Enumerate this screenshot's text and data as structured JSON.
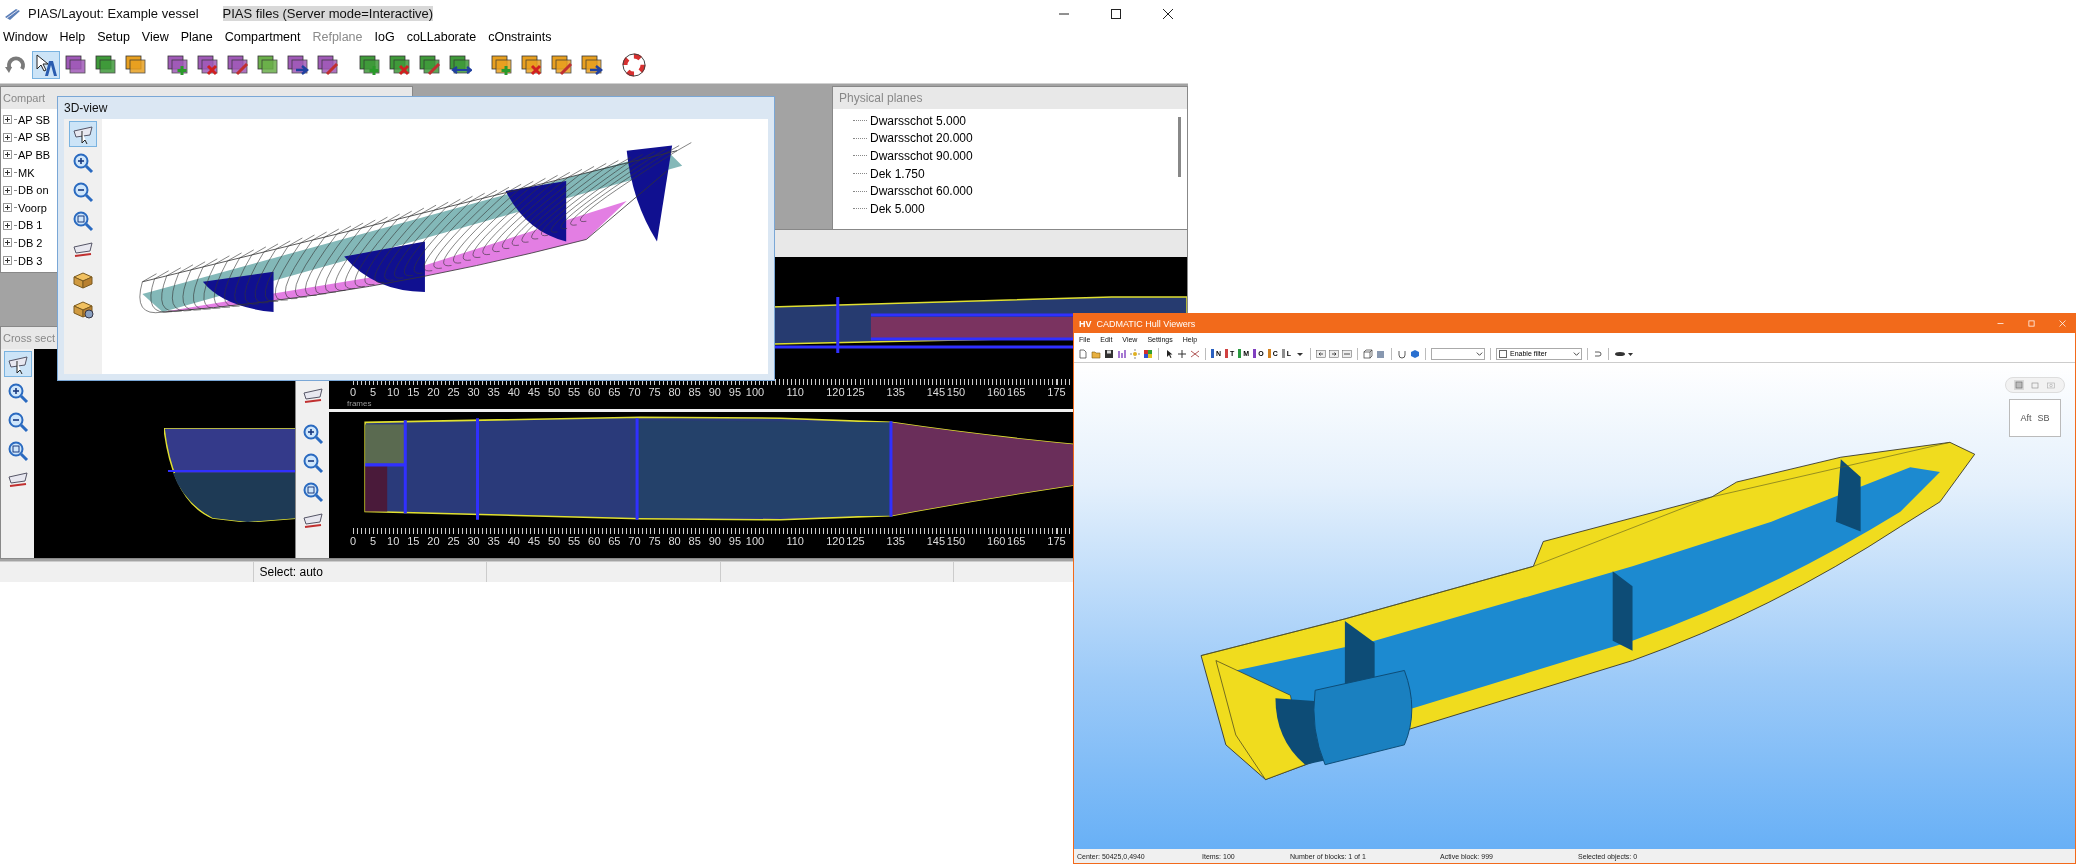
{
  "pias": {
    "title": "PIAS/Layout: Example vessel",
    "subtitle": "PIAS files (Server mode=Interactive)",
    "menu": [
      {
        "label": "Window",
        "disabled": false
      },
      {
        "label": "Help",
        "disabled": false
      },
      {
        "label": "Setup",
        "disabled": false
      },
      {
        "label": "View",
        "disabled": false
      },
      {
        "label": "Plane",
        "disabled": false
      },
      {
        "label": "Compartment",
        "disabled": false
      },
      {
        "label": "Refplane",
        "disabled": true
      },
      {
        "label": "IoG",
        "disabled": false
      },
      {
        "label": "coLLaborate",
        "disabled": false
      },
      {
        "label": "cOnstraints",
        "disabled": false
      }
    ],
    "toolbar": [
      [
        {
          "kind": "undo",
          "color": "#7a7a7a",
          "selected": false
        },
        {
          "kind": "select",
          "color": "#2a5db0",
          "selected": true
        },
        {
          "kind": "stack",
          "color": "#a05ab8",
          "selected": false
        },
        {
          "kind": "stack",
          "color": "#3f9a3a",
          "selected": false
        },
        {
          "kind": "stack",
          "color": "#e8a020",
          "selected": false
        }
      ],
      [
        {
          "kind": "add",
          "color": "#a05ab8",
          "selected": false
        },
        {
          "kind": "delete",
          "color": "#a05ab8",
          "selected": false
        },
        {
          "kind": "edit",
          "color": "#a05ab8",
          "selected": false
        },
        {
          "kind": "stack",
          "color": "#6bb04a",
          "selected": false
        },
        {
          "kind": "move",
          "color": "#a05ab8",
          "selected": false
        },
        {
          "kind": "edit",
          "color": "#a05ab8",
          "selected": false
        }
      ],
      [
        {
          "kind": "add",
          "color": "#3f9a3a",
          "selected": false
        },
        {
          "kind": "delete",
          "color": "#3f9a3a",
          "selected": false
        },
        {
          "kind": "edit",
          "color": "#3f9a3a",
          "selected": false
        },
        {
          "kind": "swap",
          "color": "#3f9a3a",
          "selected": false
        }
      ],
      [
        {
          "kind": "add",
          "color": "#e8a020",
          "selected": false
        },
        {
          "kind": "delete",
          "color": "#e8a020",
          "selected": false
        },
        {
          "kind": "edit",
          "color": "#e8a020",
          "selected": false
        },
        {
          "kind": "move",
          "color": "#e8a020",
          "selected": false
        }
      ],
      [
        {
          "kind": "lifebuoy",
          "color": "#d83030",
          "selected": false
        }
      ]
    ],
    "compartments": {
      "title": "Compart",
      "items": [
        {
          "label": "AP SB",
          "expanded": false
        },
        {
          "label": "AP SB",
          "expanded": false
        },
        {
          "label": "AP BB",
          "expanded": false
        },
        {
          "label": "MK",
          "expanded": false
        },
        {
          "label": "DB on",
          "expanded": false
        },
        {
          "label": "Voorp",
          "expanded": false
        },
        {
          "label": "DB 1",
          "expanded": false
        },
        {
          "label": "DB 2",
          "expanded": false
        },
        {
          "label": "DB 3",
          "expanded": false
        }
      ]
    },
    "physical_planes": {
      "title": "Physical planes",
      "items": [
        "Dwarsschot 5.000",
        "Dwarsschot 20.000",
        "Dwarsschot 90.000",
        "Dek 1.750",
        "Dwarsschot 60.000",
        "Dek 5.000"
      ]
    },
    "view_3d": {
      "title": "3D-view",
      "tools": [
        {
          "kind": "pan",
          "selected": true
        },
        {
          "kind": "zoom-in",
          "selected": false
        },
        {
          "kind": "zoom-out",
          "selected": false
        },
        {
          "kind": "zoom-fit",
          "selected": false
        },
        {
          "kind": "measure",
          "selected": false
        },
        {
          "kind": "box",
          "selected": false
        },
        {
          "kind": "box-gear",
          "selected": false
        }
      ]
    },
    "cross_section": {
      "title": "Cross sect",
      "tools": [
        {
          "kind": "pan",
          "selected": true
        },
        {
          "kind": "zoom-in",
          "selected": false
        },
        {
          "kind": "zoom-out",
          "selected": false
        },
        {
          "kind": "zoom-fit",
          "selected": false
        },
        {
          "kind": "measure",
          "selected": false
        }
      ]
    },
    "side_views": [
      {
        "tools": [
          {
            "kind": "measure",
            "selected": false
          }
        ],
        "ruler": {
          "unit": "frames",
          "ticks": [
            "0",
            "5",
            "10",
            "15",
            "20",
            "25",
            "30",
            "35",
            "40",
            "45",
            "50",
            "55",
            "60",
            "65",
            "70",
            "75",
            "80",
            "85",
            "90",
            "95",
            "100",
            "110",
            "120",
            "125",
            "135",
            "145",
            "150",
            "160",
            "165",
            "175"
          ]
        }
      },
      {
        "tools": [
          {
            "kind": "zoom-in",
            "selected": false
          },
          {
            "kind": "zoom-out",
            "selected": false
          },
          {
            "kind": "zoom-fit",
            "selected": false
          },
          {
            "kind": "measure",
            "selected": false
          }
        ],
        "ruler": {
          "ticks": [
            "0",
            "5",
            "10",
            "15",
            "20",
            "25",
            "30",
            "35",
            "40",
            "45",
            "50",
            "55",
            "60",
            "65",
            "70",
            "75",
            "80",
            "85",
            "90",
            "95",
            "100",
            "110",
            "120",
            "125",
            "135",
            "145",
            "150",
            "160",
            "165",
            "175"
          ]
        }
      }
    ],
    "status_bar": {
      "select": "Select: auto"
    }
  },
  "cadmatic": {
    "badge": "HV",
    "title": "CADMATIC Hull Viewers",
    "menu": [
      "File",
      "Edit",
      "View",
      "Settings",
      "Help"
    ],
    "view_buttons": [
      {
        "label": "N",
        "color": "#2a60c0"
      },
      {
        "label": "T",
        "color": "#d04040"
      },
      {
        "label": "M",
        "color": "#2a9a40"
      },
      {
        "label": "O",
        "color": "#8040c0"
      },
      {
        "label": "C",
        "color": "#d08020"
      },
      {
        "label": "L",
        "color": "#909090"
      }
    ],
    "filter": {
      "label": "Enable filter",
      "checked": false
    },
    "view_modes": [
      {
        "kind": "cube",
        "selected": true
      },
      {
        "kind": "box",
        "selected": false
      },
      {
        "kind": "camera",
        "selected": false
      }
    ],
    "cube": {
      "faces": [
        "Aft",
        "SB"
      ]
    },
    "status": [
      "Center: 50425,0,4940",
      "Items: 100",
      "Number of blocks: 1 of 1",
      "Active block: 999",
      "Selected objects: 0"
    ]
  }
}
